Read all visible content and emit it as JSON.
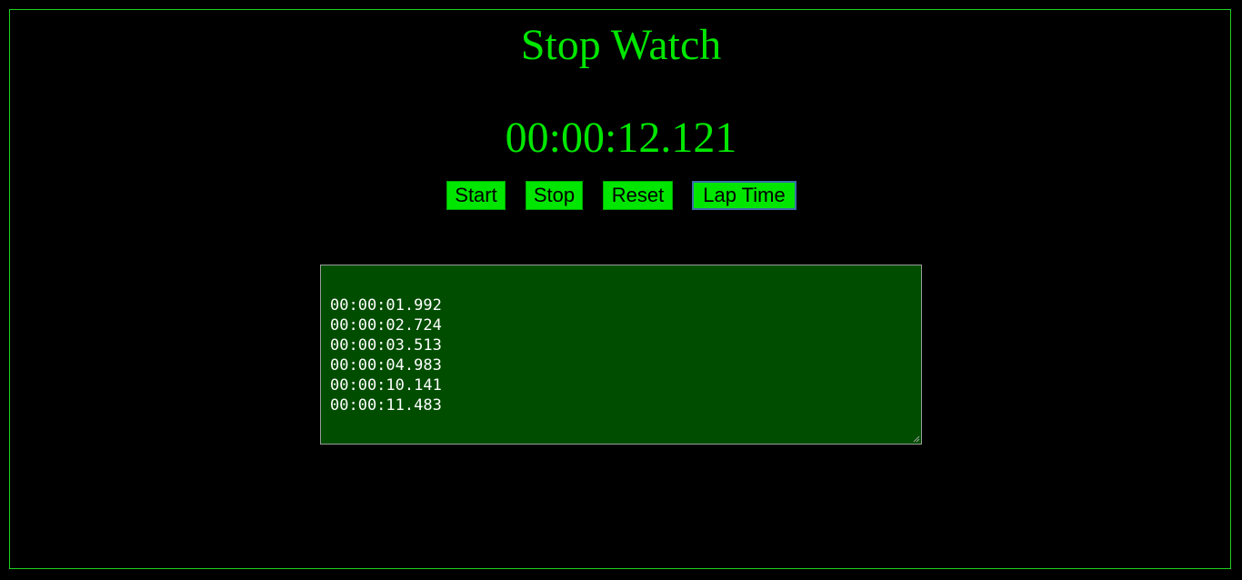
{
  "app": {
    "title": "Stop Watch",
    "display_time": "00:00:12.121"
  },
  "controls": {
    "start_label": "Start",
    "stop_label": "Stop",
    "reset_label": "Reset",
    "lap_label": "Lap Time"
  },
  "laps": [
    "00:00:01.992",
    "00:00:02.724",
    "00:00:03.513",
    "00:00:04.983",
    "00:00:10.141",
    "00:00:11.483"
  ],
  "colors": {
    "background": "#000000",
    "accent": "#00e600",
    "lap_area_background": "#004d00",
    "lap_text": "#ffffff"
  }
}
